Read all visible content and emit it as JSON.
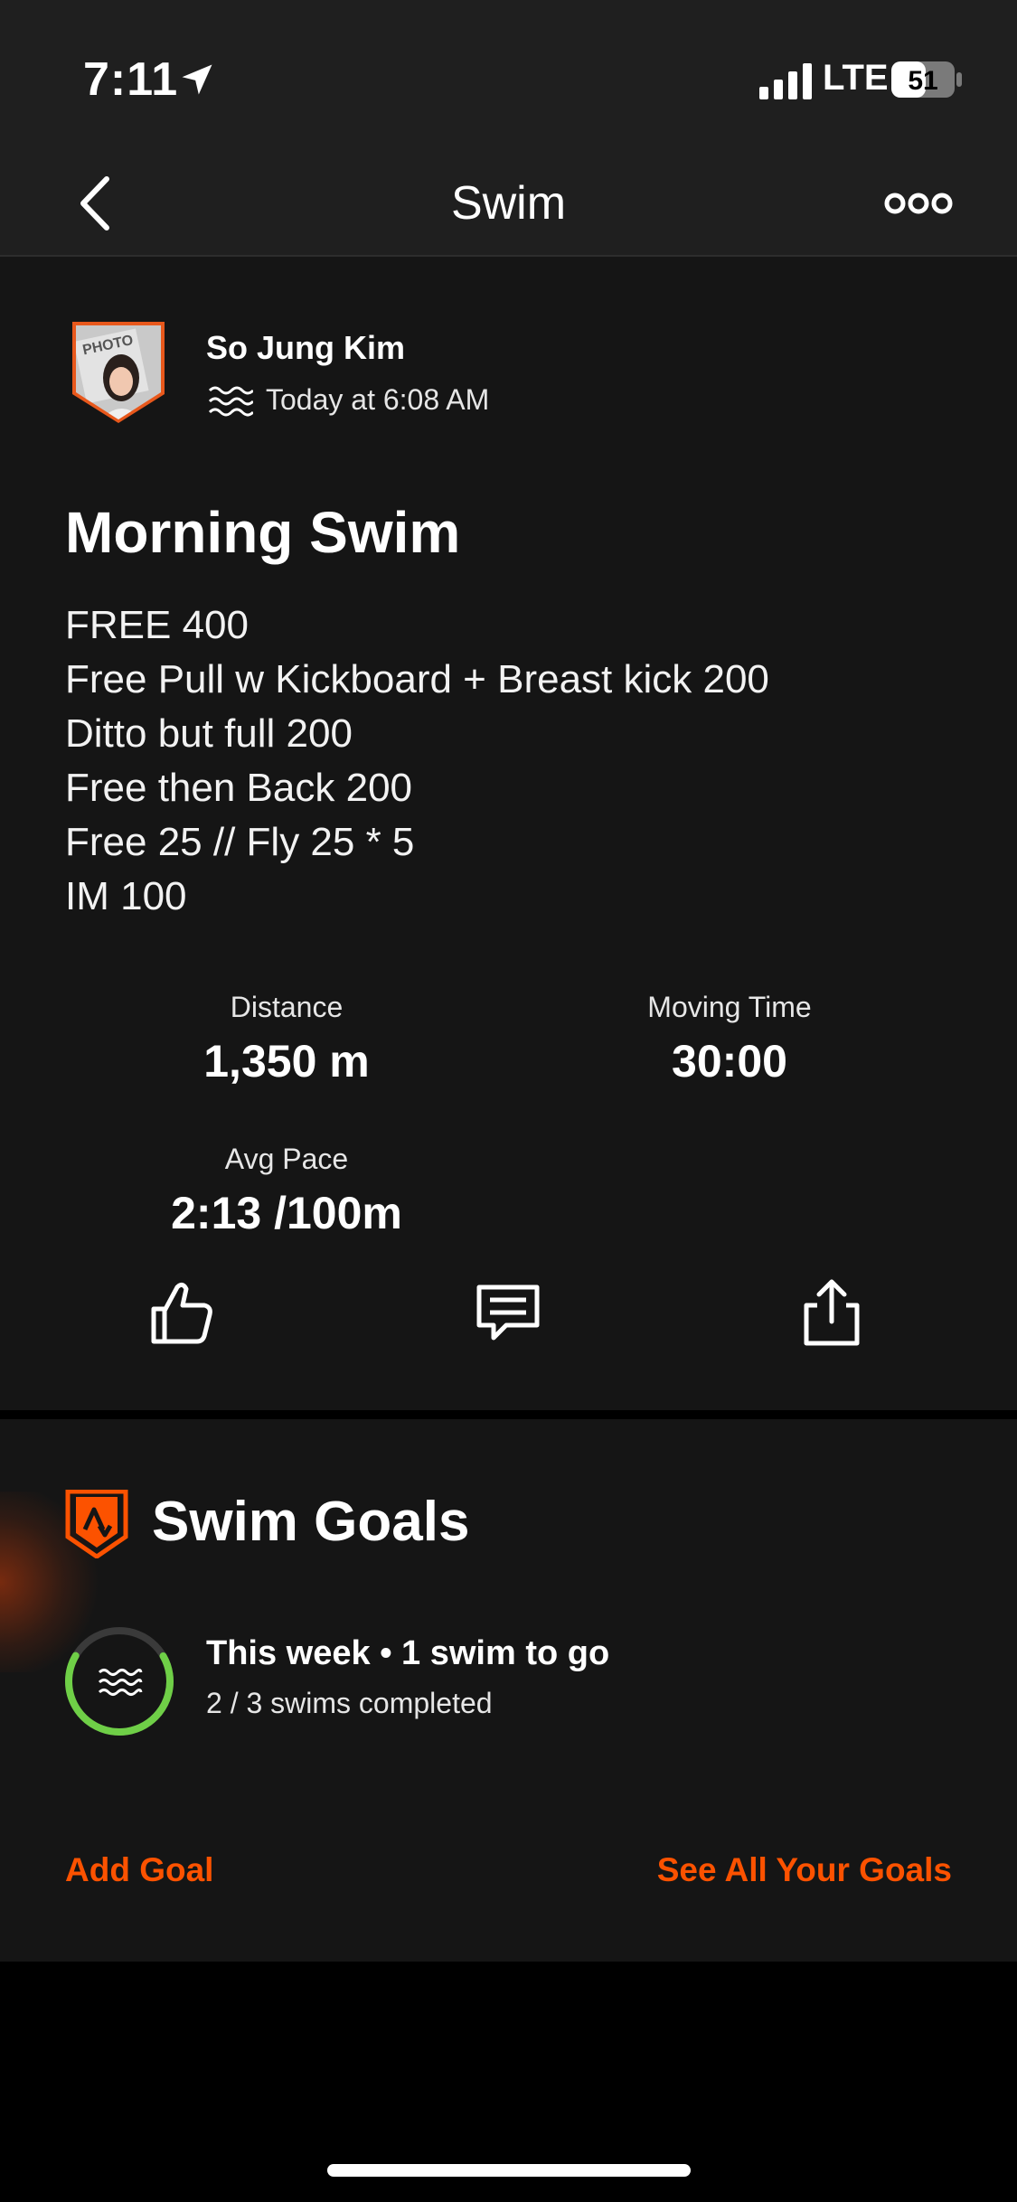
{
  "status": {
    "time": "7:11",
    "network": "LTE",
    "battery": "51"
  },
  "nav": {
    "title": "Swim"
  },
  "activity": {
    "athlete": "So Jung Kim",
    "date": "Today at 6:08 AM",
    "title": "Morning Swim",
    "description": [
      "FREE 400",
      "Free Pull w Kickboard + Breast kick 200",
      "Ditto but full 200",
      "Free then Back 200",
      "Free 25 // Fly 25 * 5",
      "IM 100"
    ],
    "stats": {
      "distance": {
        "label": "Distance",
        "value": "1,350 m"
      },
      "moving_time": {
        "label": "Moving Time",
        "value": "30:00"
      },
      "avg_pace": {
        "label": "Avg Pace",
        "value": "2:13 /100m"
      }
    }
  },
  "goals": {
    "title": "Swim Goals",
    "headline": "This week • 1 swim to go",
    "subtitle": "2 / 3 swims completed",
    "progress": 0.667,
    "add_goal": "Add Goal",
    "see_all": "See All Your Goals"
  },
  "colors": {
    "accent": "#fc5200",
    "progress_ring": "#6fcf47",
    "card_bg": "#151515"
  }
}
